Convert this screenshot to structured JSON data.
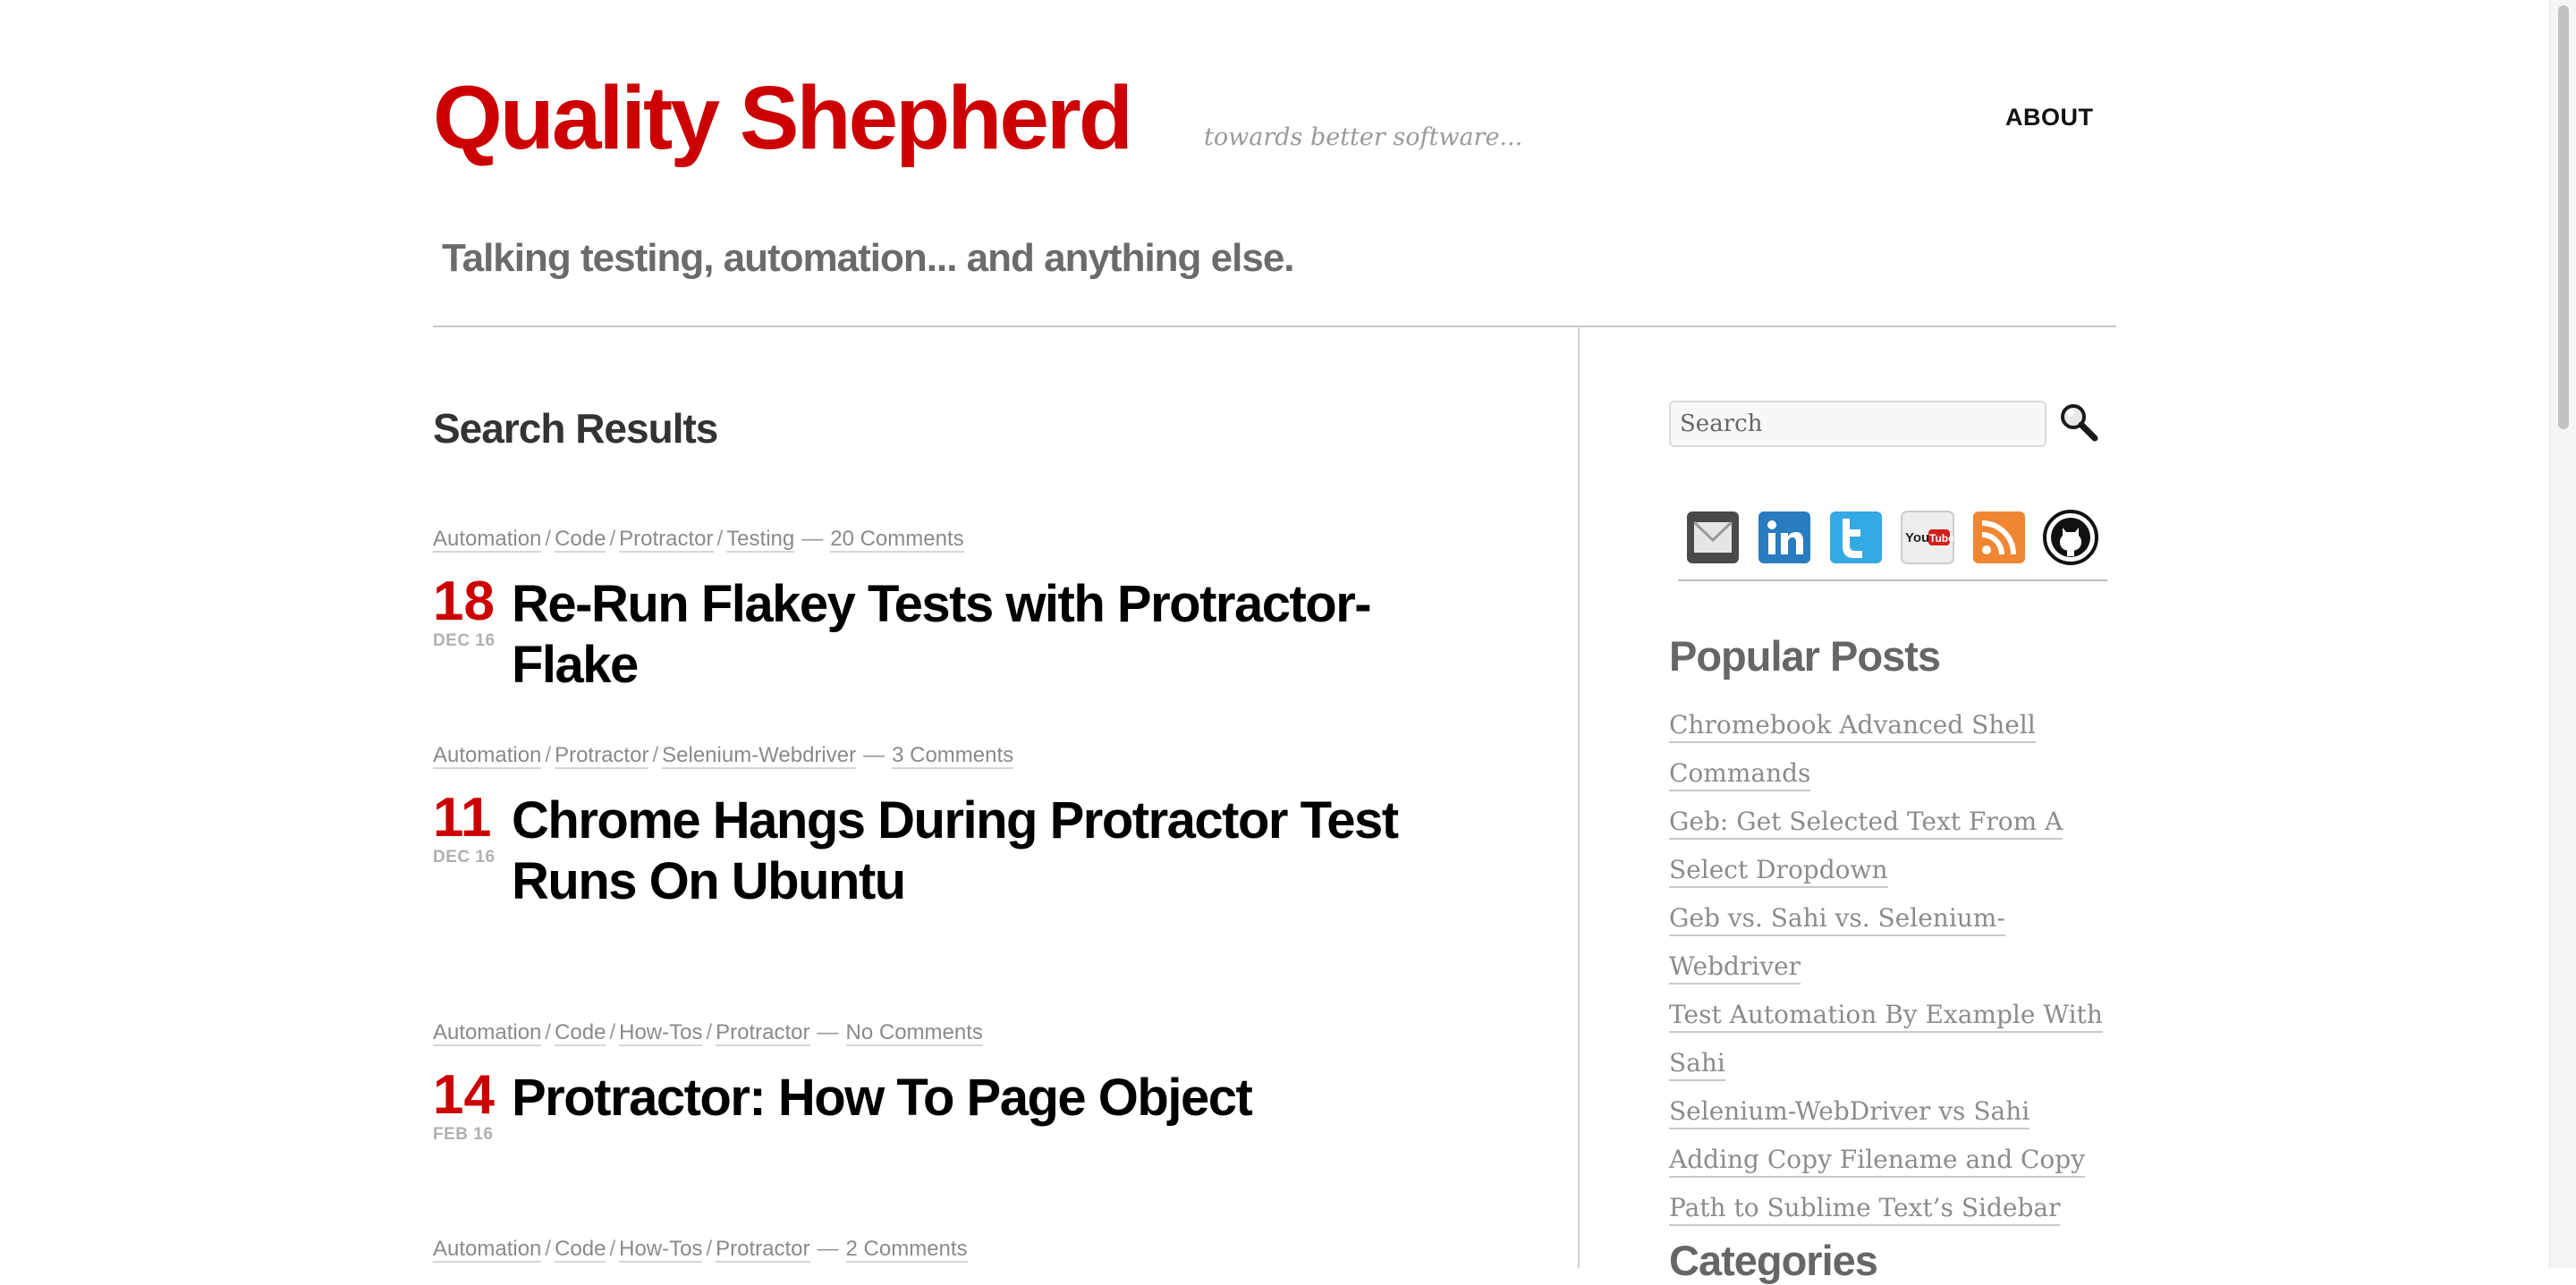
{
  "header": {
    "site_title": "Quality Shepherd",
    "site_description": "towards better software...",
    "nav_about": "ABOUT",
    "tagline": "Talking testing, automation... and anything else."
  },
  "main": {
    "results_title": "Search Results",
    "posts": [
      {
        "categories": [
          "Automation",
          "Code",
          "Protractor",
          "Testing"
        ],
        "comments": "20 Comments",
        "day": "18",
        "month": "DEC 16",
        "title": "Re-Run Flakey Tests with Protractor-Flake"
      },
      {
        "categories": [
          "Automation",
          "Protractor",
          "Selenium-Webdriver"
        ],
        "comments": "3 Comments",
        "day": "11",
        "month": "DEC 16",
        "title": "Chrome Hangs During Protractor Test Runs On Ubuntu"
      },
      {
        "categories": [
          "Automation",
          "Code",
          "How-Tos",
          "Protractor"
        ],
        "comments": "No Comments",
        "day": "14",
        "month": "FEB 16",
        "title": "Protractor: How To Page Object"
      },
      {
        "categories": [
          "Automation",
          "Code",
          "How-Tos",
          "Protractor"
        ],
        "comments": "2 Comments"
      }
    ]
  },
  "sidebar": {
    "search_placeholder": "Search",
    "social_icons": [
      "email-icon",
      "linkedin-icon",
      "twitter-icon",
      "youtube-icon",
      "rss-icon",
      "github-icon"
    ],
    "popular_title": "Popular Posts",
    "popular_posts": [
      "Chromebook Advanced Shell Commands",
      "Geb: Get Selected Text From A Select Dropdown",
      "Geb vs. Sahi vs. Selenium-Webdriver",
      "Test Automation By Example With Sahi",
      "Selenium-WebDriver vs Sahi",
      "Adding Copy Filename and Copy Path to Sublime Text’s Sidebar"
    ],
    "categories_title": "Categories"
  },
  "colors": {
    "brand_red": "#cc0000",
    "muted_gray": "#8a8a8a",
    "title_gray": "#666666"
  }
}
